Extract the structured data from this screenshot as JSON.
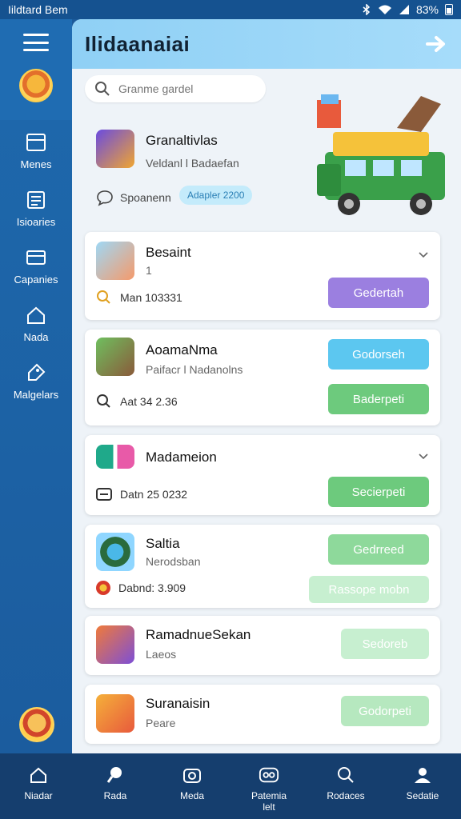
{
  "status_bar": {
    "left_text": "Iildtard Bem",
    "battery": "83%"
  },
  "sidebar": {
    "items": [
      {
        "label": "Menes",
        "icon": "store-icon"
      },
      {
        "label": "Isioaries",
        "icon": "list-icon"
      },
      {
        "label": "Capanies",
        "icon": "card-icon"
      },
      {
        "label": "Nada",
        "icon": "home-icon"
      },
      {
        "label": "Malgelars",
        "icon": "tag-icon"
      }
    ]
  },
  "header": {
    "title": "Ilidaanaiai"
  },
  "search": {
    "placeholder": "Granme gardel"
  },
  "featured": {
    "name": "Granaltivlas",
    "subtitle": "Veldanl l Badaefan",
    "chat_label": "Spoanenn",
    "pill": "Adapler 2200"
  },
  "cards": [
    {
      "title": "Besaint",
      "sub": "1",
      "meta": "Man 103331",
      "buttons": [
        "Gedertah"
      ]
    },
    {
      "title": "AoamaNma",
      "sub": "Paifacr l Nadanolns",
      "meta": "Aat 34  2.36",
      "buttons": [
        "Godorseh",
        "Baderpeti"
      ]
    },
    {
      "title": "Madameion",
      "sub": "",
      "meta": "Datn 25 0232",
      "buttons": [
        "Secierpeti"
      ]
    },
    {
      "title": "Saltia",
      "sub": "Nerodsban",
      "meta": "Dabnd: 3.909",
      "buttons": [
        "Gedrreed",
        "Rassope mobn"
      ]
    },
    {
      "title": "RamadnueSekan",
      "sub": "Laeos",
      "meta": "",
      "buttons": [
        "Sedoreb"
      ]
    },
    {
      "title": "Suranaisin",
      "sub": "Peare",
      "meta": "",
      "buttons": [
        "Godorpeti"
      ]
    }
  ],
  "bottom_nav": [
    {
      "label": "Niadar",
      "icon": "home-icon"
    },
    {
      "label": "Rada",
      "icon": "pin-icon"
    },
    {
      "label": "Meda",
      "icon": "camera-icon"
    },
    {
      "label": "Patemia lelt",
      "icon": "chat-icon"
    },
    {
      "label": "Rodaces",
      "icon": "search-icon"
    },
    {
      "label": "Sedatie",
      "icon": "profile-icon"
    }
  ],
  "colors": {
    "purple": "#9b7fe0",
    "blue": "#5cc7f0",
    "green": "#6dca7d",
    "light_green": "#b6e8bf"
  }
}
